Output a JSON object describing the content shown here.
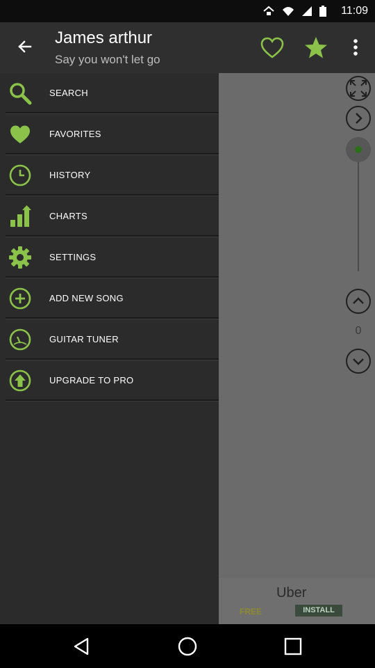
{
  "status_bar": {
    "time": "11:09",
    "icons": [
      "network-icon",
      "wifi-icon",
      "signal-icon",
      "battery-icon"
    ]
  },
  "app_bar": {
    "title": "James arthur",
    "subtitle": "Say you won't let go",
    "actions": [
      "back-arrow-icon",
      "favorite-heart-icon",
      "star-icon",
      "more-vert-icon"
    ]
  },
  "drawer": {
    "items": [
      {
        "label": "SEARCH",
        "icon": "search-icon"
      },
      {
        "label": "FAVORITES",
        "icon": "heart-icon"
      },
      {
        "label": "HISTORY",
        "icon": "clock-icon"
      },
      {
        "label": "CHARTS",
        "icon": "bar-chart-icon"
      },
      {
        "label": "SETTINGS",
        "icon": "gear-icon"
      },
      {
        "label": "ADD NEW SONG",
        "icon": "plus-circle-icon"
      },
      {
        "label": "GUITAR TUNER",
        "icon": "tuner-icon"
      },
      {
        "label": "UPGRADE TO PRO",
        "icon": "upgrade-arrow-icon"
      }
    ]
  },
  "side_panel": {
    "counter": "0",
    "icons": [
      "fullscreen-icon",
      "chevron-right-icon",
      "slider-knob",
      "chevron-up-icon",
      "chevron-down-icon"
    ]
  },
  "ad": {
    "title": "Uber",
    "free_label": "FREE",
    "install_label": "INSTALL"
  },
  "colors": {
    "accent": "#8bc34a",
    "app_bar": "#2f2f2f",
    "drawer": "#2b2b2b",
    "content": "#6b6b6b"
  }
}
